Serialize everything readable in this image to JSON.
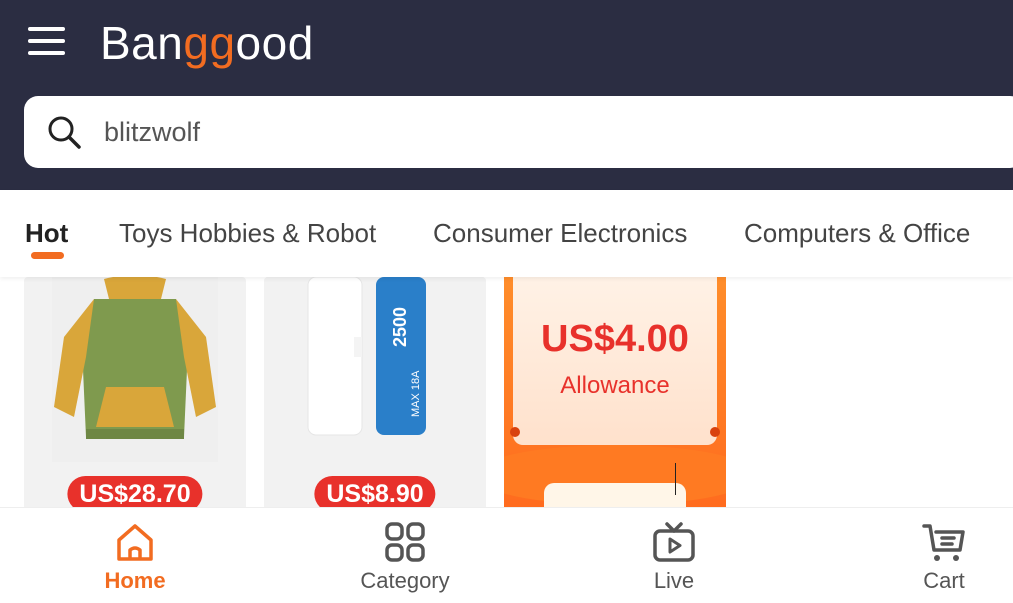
{
  "header": {
    "logo_prefix": "Ban",
    "logo_highlight": "gg",
    "logo_suffix": "ood",
    "menu_icon": "hamburger-menu-icon",
    "brand_color": "#f26c21",
    "bg_color": "#2b2d42"
  },
  "search": {
    "value": "blitzwolf",
    "icon": "search-icon"
  },
  "tabs": [
    {
      "label": "Hot",
      "active": true
    },
    {
      "label": "Toys Hobbies & Robot",
      "active": false
    },
    {
      "label": "Consumer Electronics",
      "active": false
    },
    {
      "label": "Computers & Office",
      "active": false
    }
  ],
  "products": [
    {
      "price": "US$28.70",
      "image": "hoodie-image"
    },
    {
      "price": "US$8.90",
      "image": "battery-image"
    }
  ],
  "coupon": {
    "amount": "US$4.00",
    "label": "Allowance"
  },
  "bottom_nav": [
    {
      "label": "Home",
      "icon": "home-icon",
      "active": true
    },
    {
      "label": "Category",
      "icon": "grid-icon",
      "active": false
    },
    {
      "label": "Live",
      "icon": "tv-icon",
      "active": false
    },
    {
      "label": "Cart",
      "icon": "cart-icon",
      "active": false
    }
  ],
  "colors": {
    "accent": "#f26c21",
    "price_badge": "#e8312b"
  }
}
